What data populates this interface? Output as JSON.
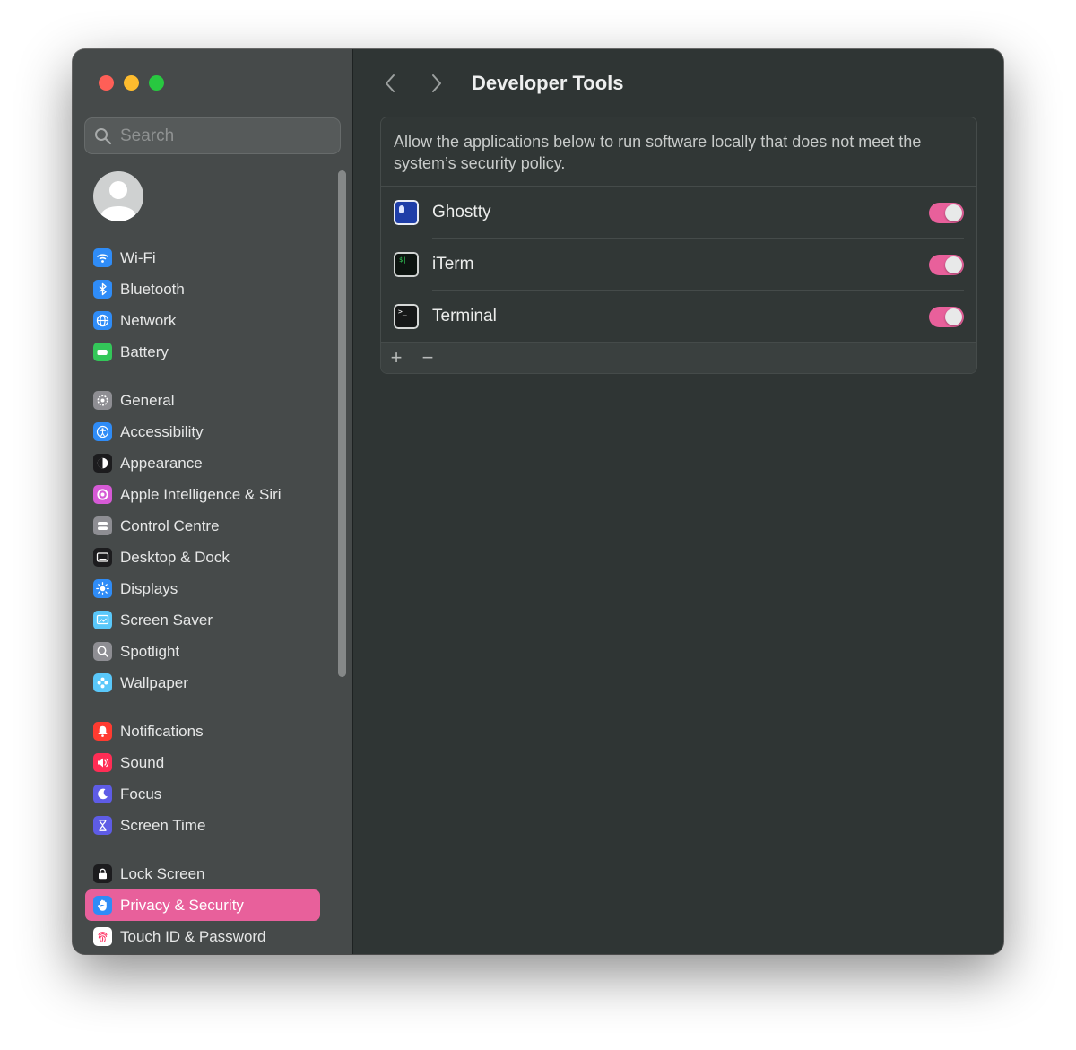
{
  "sidebar": {
    "search_placeholder": "Search",
    "groups": [
      [
        {
          "label": "Wi-Fi",
          "icon": "wifi-icon",
          "color": "#2f8cf7"
        },
        {
          "label": "Bluetooth",
          "icon": "bluetooth-icon",
          "color": "#2f8cf7"
        },
        {
          "label": "Network",
          "icon": "globe-icon",
          "color": "#2f8cf7"
        },
        {
          "label": "Battery",
          "icon": "battery-icon",
          "color": "#33c759"
        }
      ],
      [
        {
          "label": "General",
          "icon": "gear-icon",
          "color": "#8e8e93"
        },
        {
          "label": "Accessibility",
          "icon": "accessibility-icon",
          "color": "#2f8cf7"
        },
        {
          "label": "Appearance",
          "icon": "appearance-icon",
          "color": "#1c1c1e"
        },
        {
          "label": "Apple Intelligence & Siri",
          "icon": "siri-icon",
          "color": "#d65ad6"
        },
        {
          "label": "Control Centre",
          "icon": "control-centre-icon",
          "color": "#8e8e93"
        },
        {
          "label": "Desktop & Dock",
          "icon": "dock-icon",
          "color": "#1c1c1e"
        },
        {
          "label": "Displays",
          "icon": "sun-icon",
          "color": "#2f8cf7"
        },
        {
          "label": "Screen Saver",
          "icon": "screen-saver-icon",
          "color": "#5ac8fa"
        },
        {
          "label": "Spotlight",
          "icon": "magnifier-icon",
          "color": "#8e8e93"
        },
        {
          "label": "Wallpaper",
          "icon": "flower-icon",
          "color": "#5ac8fa"
        }
      ],
      [
        {
          "label": "Notifications",
          "icon": "bell-icon",
          "color": "#ff3b30"
        },
        {
          "label": "Sound",
          "icon": "speaker-icon",
          "color": "#ff2d55"
        },
        {
          "label": "Focus",
          "icon": "moon-icon",
          "color": "#5e5ce6"
        },
        {
          "label": "Screen Time",
          "icon": "hourglass-icon",
          "color": "#5e5ce6"
        }
      ],
      [
        {
          "label": "Lock Screen",
          "icon": "lock-icon",
          "color": "#1c1c1e"
        },
        {
          "label": "Privacy & Security",
          "icon": "hand-icon",
          "color": "#2f8cf7",
          "active": true
        },
        {
          "label": "Touch ID & Password",
          "icon": "fingerprint-icon",
          "color": "#ffffff"
        }
      ]
    ]
  },
  "header": {
    "title": "Developer Tools"
  },
  "panel": {
    "description": "Allow the applications below to run software locally that does not meet the system’s security policy.",
    "apps": [
      {
        "name": "Ghostty",
        "icon": "ghostty-app-icon",
        "enabled": true
      },
      {
        "name": "iTerm",
        "icon": "iterm-app-icon",
        "enabled": true
      },
      {
        "name": "Terminal",
        "icon": "terminal-app-icon",
        "enabled": true
      }
    ],
    "add_label": "+",
    "remove_label": "−"
  },
  "colors": {
    "accent": "#e8609b",
    "sidebar_bg": "#464a4a",
    "content_bg": "#2f3534"
  }
}
